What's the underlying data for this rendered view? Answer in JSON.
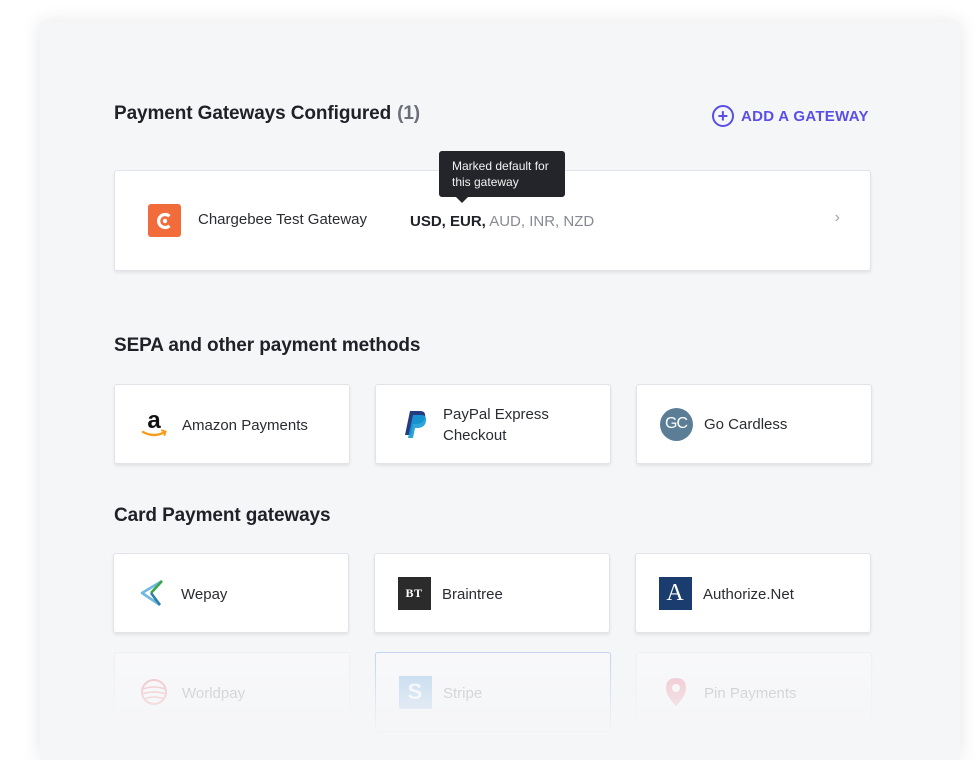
{
  "configured": {
    "title": "Payment Gateways Configured",
    "count": "(1)",
    "add_label": "ADD A GATEWAY",
    "add_icon": "plus-circle-icon",
    "gateway": {
      "name": "Chargebee Test Gateway",
      "currencies_bold": [
        "USD,",
        "EUR,"
      ],
      "currencies_rest": "AUD, INR, NZD",
      "icon": "chargebee-logo-icon"
    },
    "tooltip": "Marked default for this gateway"
  },
  "sepa": {
    "title": "SEPA and other payment methods",
    "items": [
      {
        "label": "Amazon Payments",
        "icon": "amazon-logo-icon"
      },
      {
        "label": "PayPal Express Checkout",
        "icon": "paypal-logo-icon"
      },
      {
        "label": "Go Cardless",
        "icon": "gocardless-logo-icon"
      }
    ]
  },
  "card": {
    "title": "Card Payment gateways",
    "items": [
      {
        "label": "Wepay",
        "icon": "wepay-logo-icon"
      },
      {
        "label": "Braintree",
        "icon": "braintree-logo-icon"
      },
      {
        "label": "Authorize.Net",
        "icon": "authorize-net-logo-icon"
      },
      {
        "label": "Worldpay",
        "icon": "worldpay-logo-icon"
      },
      {
        "label": "Stripe",
        "icon": "stripe-logo-icon"
      },
      {
        "label": "Pin Payments",
        "icon": "pin-payments-logo-icon"
      }
    ]
  },
  "colors": {
    "accent": "#5a4ee6",
    "chargebee": "#f26b3a",
    "paypal": "#253b80",
    "gocardless": "#5b7e96",
    "authorize": "#1b3c6e"
  }
}
